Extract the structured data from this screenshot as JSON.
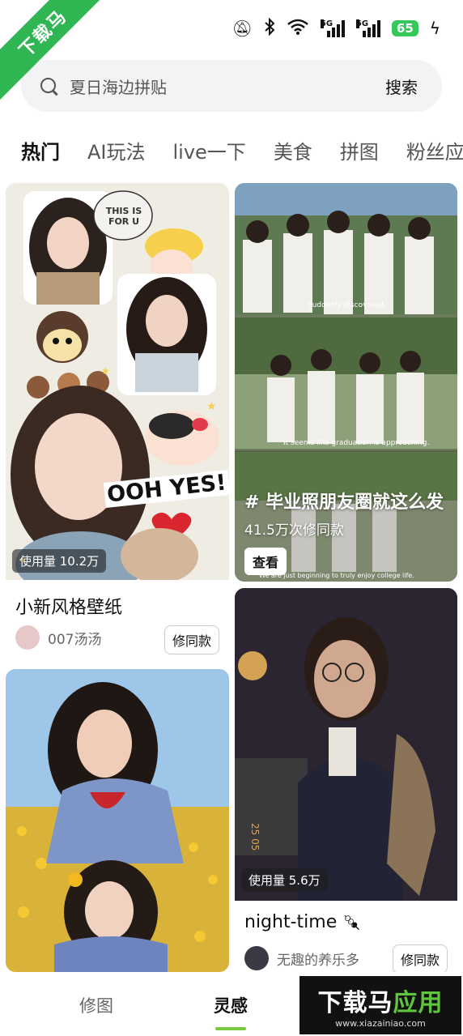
{
  "watermark": {
    "ribbon": "下载马",
    "brand_part1": "下载马",
    "brand_part2": "应用",
    "url": "www.xiazainiao.com"
  },
  "status_bar": {
    "network1": "5G",
    "network2": "5G",
    "battery": "65"
  },
  "search": {
    "placeholder": "夏日海边拼贴",
    "button": "搜索"
  },
  "tabs": [
    {
      "label": "热门",
      "active": true
    },
    {
      "label": "AI玩法",
      "active": false
    },
    {
      "label": "live一下",
      "active": false
    },
    {
      "label": "美食",
      "active": false
    },
    {
      "label": "拼图",
      "active": false
    },
    {
      "label": "粉丝应",
      "active": false
    }
  ],
  "cards": {
    "c1": {
      "usage": "使用量 10.2万",
      "title": "小新风格壁纸",
      "author": "007汤汤",
      "remix": "修同款",
      "stickers": {
        "bubble": "THIS IS FOR U",
        "banner": "OOH YES!"
      }
    },
    "c2": {
      "topic": "# 毕业照朋友圈就这么发",
      "count": "41.5万次修同款",
      "view": "查看",
      "captions": [
        "Suddenly discovered.",
        "It seems like graduation is approaching.",
        "We are just beginning to truly enjoy college life."
      ]
    },
    "c3": {
      "usage": "使用量 5.6万",
      "title": "night-time",
      "author": "无趣的养乐多",
      "remix": "修同款",
      "vertical": "25 05"
    },
    "c4": {}
  },
  "bottom_nav": {
    "edit": "修图",
    "inspiration": "灵感"
  },
  "colors": {
    "accent": "#7ac943",
    "brand_green": "#2fb552"
  }
}
